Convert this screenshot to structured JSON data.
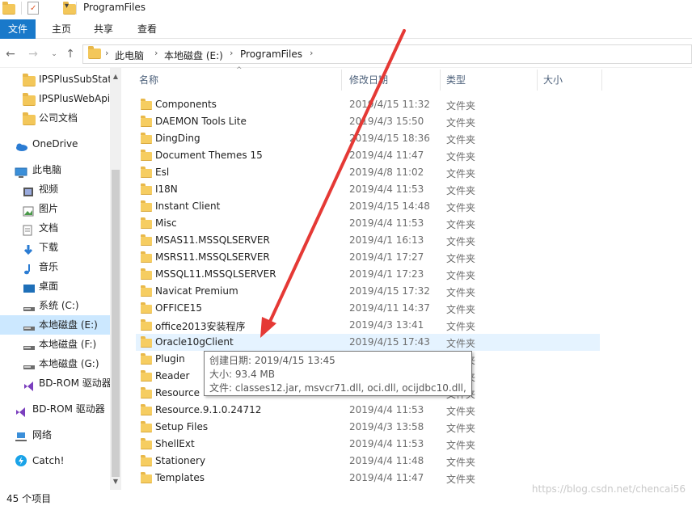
{
  "window": {
    "title": "ProgramFiles"
  },
  "ribbon": {
    "tabs": [
      "文件",
      "主页",
      "共享",
      "查看"
    ]
  },
  "address": {
    "crumbs": [
      "此电脑",
      "本地磁盘 (E:)",
      "ProgramFiles"
    ]
  },
  "sidebar": {
    "items": [
      {
        "label": "IPSPlusSubStat",
        "icon": "folder-icon"
      },
      {
        "label": "IPSPlusWebApi",
        "icon": "folder-icon"
      },
      {
        "label": "公司文档",
        "icon": "folder-icon"
      },
      {
        "label": "OneDrive",
        "icon": "cloud-icon"
      },
      {
        "label": "此电脑",
        "icon": "computer-icon"
      },
      {
        "label": "视频",
        "icon": "video-icon"
      },
      {
        "label": "图片",
        "icon": "picture-icon"
      },
      {
        "label": "文档",
        "icon": "document-icon"
      },
      {
        "label": "下载",
        "icon": "download-icon"
      },
      {
        "label": "音乐",
        "icon": "music-icon"
      },
      {
        "label": "桌面",
        "icon": "desktop-icon"
      },
      {
        "label": "系统 (C:)",
        "icon": "drive-icon"
      },
      {
        "label": "本地磁盘 (E:)",
        "icon": "drive-icon",
        "selected": true
      },
      {
        "label": "本地磁盘 (F:)",
        "icon": "drive-icon"
      },
      {
        "label": "本地磁盘 (G:)",
        "icon": "drive-icon"
      },
      {
        "label": "BD-ROM 驱动器",
        "icon": "visual-studio-icon"
      },
      {
        "label": "BD-ROM 驱动器",
        "icon": "visual-studio-icon"
      },
      {
        "label": "网络",
        "icon": "network-icon"
      },
      {
        "label": "Catch!",
        "icon": "catch-icon"
      }
    ]
  },
  "list": {
    "columns": [
      "名称",
      "修改日期",
      "类型",
      "大小"
    ],
    "rows": [
      {
        "name": "Components",
        "date": "2019/4/15 11:32",
        "type": "文件夹"
      },
      {
        "name": "DAEMON Tools Lite",
        "date": "2019/4/3 15:50",
        "type": "文件夹"
      },
      {
        "name": "DingDing",
        "date": "2019/4/15 18:36",
        "type": "文件夹"
      },
      {
        "name": "Document Themes 15",
        "date": "2019/4/4 11:47",
        "type": "文件夹"
      },
      {
        "name": "Esl",
        "date": "2019/4/8 11:02",
        "type": "文件夹"
      },
      {
        "name": "I18N",
        "date": "2019/4/4 11:53",
        "type": "文件夹"
      },
      {
        "name": "Instant Client",
        "date": "2019/4/15 14:48",
        "type": "文件夹"
      },
      {
        "name": "Misc",
        "date": "2019/4/4 11:53",
        "type": "文件夹"
      },
      {
        "name": "MSAS11.MSSQLSERVER",
        "date": "2019/4/1 16:13",
        "type": "文件夹"
      },
      {
        "name": "MSRS11.MSSQLSERVER",
        "date": "2019/4/1 17:27",
        "type": "文件夹"
      },
      {
        "name": "MSSQL11.MSSQLSERVER",
        "date": "2019/4/1 17:23",
        "type": "文件夹"
      },
      {
        "name": "Navicat Premium",
        "date": "2019/4/15 17:32",
        "type": "文件夹"
      },
      {
        "name": "OFFICE15",
        "date": "2019/4/11 14:37",
        "type": "文件夹"
      },
      {
        "name": "office2013安装程序",
        "date": "2019/4/3 13:41",
        "type": "文件夹"
      },
      {
        "name": "Oracle10gClient",
        "date": "2019/4/15 17:43",
        "type": "文件夹",
        "hover": true
      },
      {
        "name": "Plugin",
        "date": "",
        "type": "文件夹"
      },
      {
        "name": "Reader",
        "date": "",
        "type": "文件夹"
      },
      {
        "name": "Resource",
        "date": "",
        "type": "文件夹"
      },
      {
        "name": "Resource.9.1.0.24712",
        "date": "2019/4/4 11:53",
        "type": "文件夹"
      },
      {
        "name": "Setup Files",
        "date": "2019/4/3 13:58",
        "type": "文件夹"
      },
      {
        "name": "ShellExt",
        "date": "2019/4/4 11:53",
        "type": "文件夹"
      },
      {
        "name": "Stationery",
        "date": "2019/4/4 11:48",
        "type": "文件夹"
      },
      {
        "name": "Templates",
        "date": "2019/4/4 11:47",
        "type": "文件夹"
      }
    ]
  },
  "tooltip": {
    "created": "创建日期: 2019/4/15 13:45",
    "size": "大小: 93.4 MB",
    "files": "文件: classes12.jar, msvcr71.dll, oci.dll, ocijdbc10.dll, ..."
  },
  "status": {
    "count": "45 个项目"
  },
  "watermark": "https://blog.csdn.net/chencai56",
  "colors": {
    "accent": "#1979ca",
    "selected": "#cce8ff",
    "hover": "#e5f3ff",
    "arrow": "#e53935",
    "folder": "#f3c75a"
  }
}
